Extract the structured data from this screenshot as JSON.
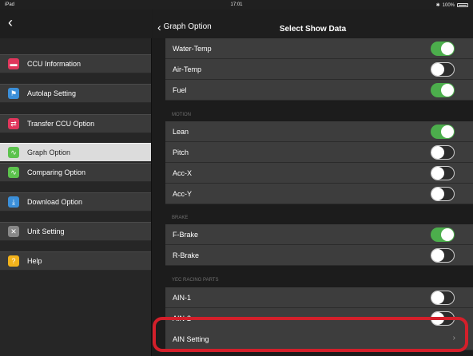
{
  "status_bar": {
    "left": "iPad",
    "time": "17:01",
    "battery": "100%"
  },
  "left_nav": {
    "back_icon": "chevron-left-icon"
  },
  "sidebar": {
    "items": [
      {
        "label": "CCU Information",
        "icon": "ccu-icon",
        "color": "#e0365c",
        "selected": false
      },
      {
        "label": "Autolap Setting",
        "icon": "flag-icon",
        "color": "#3b8fd9",
        "selected": false
      },
      {
        "label": "Transfer CCU Option",
        "icon": "transfer-icon",
        "color": "#e0365c",
        "selected": false
      },
      {
        "label": "Graph Option",
        "icon": "graph-icon",
        "color": "#5cc24d",
        "selected": true
      },
      {
        "label": "Comparing Option",
        "icon": "compare-icon",
        "color": "#5cc24d",
        "selected": false
      },
      {
        "label": "Download Option",
        "icon": "download-icon",
        "color": "#3b8fd9",
        "selected": false
      },
      {
        "label": "Unit Setting",
        "icon": "unit-icon",
        "color": "#888888",
        "selected": false
      },
      {
        "label": "Help",
        "icon": "help-icon",
        "color": "#f2b21b",
        "selected": false
      }
    ]
  },
  "right_nav": {
    "back_label": "Graph Option",
    "title": "Select Show Data"
  },
  "rows": [
    {
      "label": "Water-Temp",
      "on": true
    },
    {
      "label": "Air-Temp",
      "on": false
    },
    {
      "label": "Fuel",
      "on": true
    }
  ],
  "sections": {
    "motion": "MOTION",
    "brake": "BRAKE",
    "yec": "YEC RACING PARTS"
  },
  "motion_rows": [
    {
      "label": "Lean",
      "on": true
    },
    {
      "label": "Pitch",
      "on": false
    },
    {
      "label": "Acc-X",
      "on": false
    },
    {
      "label": "Acc-Y",
      "on": false
    }
  ],
  "brake_rows": [
    {
      "label": "F-Brake",
      "on": true
    },
    {
      "label": "R-Brake",
      "on": false
    }
  ],
  "yec_rows": [
    {
      "label": "AIN-1",
      "on": false
    },
    {
      "label": "AIN-2",
      "on": false
    }
  ],
  "ain_setting": {
    "label": "AIN Setting"
  },
  "colors": {
    "toggle_on": "#4cae4c",
    "highlight": "#d31f2a",
    "selected_bg": "#dcdcdc"
  }
}
